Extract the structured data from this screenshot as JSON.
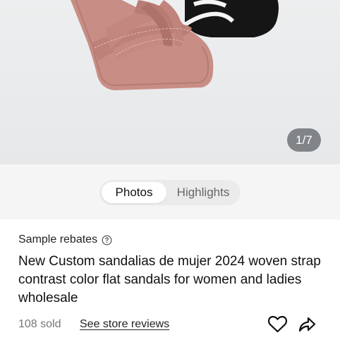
{
  "gallery": {
    "image_alt": "sandal-product-photo",
    "counter": "1/7"
  },
  "tabs": [
    {
      "label": "Photos",
      "active": true
    },
    {
      "label": "Highlights",
      "active": false
    }
  ],
  "product": {
    "rebates_label": "Sample rebates",
    "title": "New Custom sandalias de mujer 2024 woven strap contrast color flat sandals for women and ladies wholesale",
    "sold": "108 sold",
    "reviews_link": "See store reviews"
  },
  "icons": {
    "help": "question-circle-icon",
    "favorite": "heart-outline-icon",
    "share": "share-arrow-icon"
  },
  "colors": {
    "sandal_pink": "#c98f88",
    "sandal_black": "#151515",
    "counter_bg": "#5a5e62"
  }
}
